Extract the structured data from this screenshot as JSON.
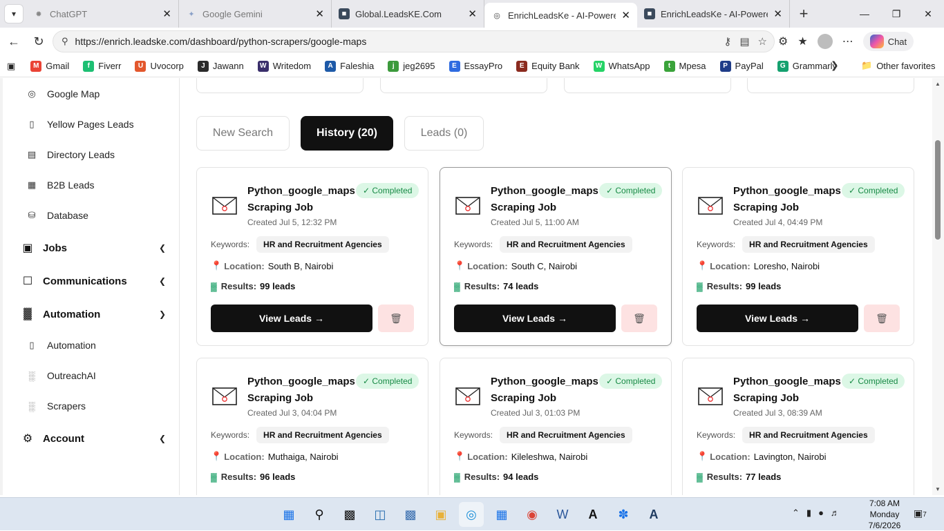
{
  "browser": {
    "tabs": [
      {
        "title": "ChatGPT",
        "favicon": "chatgpt-icon",
        "active": false,
        "dim": true
      },
      {
        "title": "Google Gemini",
        "favicon": "gemini-icon",
        "active": false,
        "dim": true
      },
      {
        "title": "Global.LeadsKE.Com",
        "favicon": "site-icon",
        "active": false,
        "dim": false
      },
      {
        "title": "EnrichLeadsKe - AI-Powered Le",
        "favicon": "globe-icon",
        "active": true,
        "dim": false
      },
      {
        "title": "EnrichLeadsKe - AI-Powered Le",
        "favicon": "site-icon",
        "active": false,
        "dim": false
      }
    ],
    "url": "https://enrich.leadske.com/dashboard/python-scrapers/google-maps",
    "chat_label": "Chat",
    "bookmarks": [
      {
        "label": "Gmail",
        "color": "#ea4335",
        "glyph": "M"
      },
      {
        "label": "Fiverr",
        "color": "#1dbf73",
        "glyph": "f"
      },
      {
        "label": "Uvocorp",
        "color": "#e3572d",
        "glyph": "U"
      },
      {
        "label": "Jawann",
        "color": "#2b2b2b",
        "glyph": "J"
      },
      {
        "label": "Writedom",
        "color": "#3a2f6b",
        "glyph": "W"
      },
      {
        "label": "Faleshia",
        "color": "#1e5aa8",
        "glyph": "A"
      },
      {
        "label": "jeg2695",
        "color": "#3c9a3c",
        "glyph": "j"
      },
      {
        "label": "EssayPro",
        "color": "#2f6be0",
        "glyph": "E"
      },
      {
        "label": "Equity Bank",
        "color": "#8b2b1f",
        "glyph": "E"
      },
      {
        "label": "WhatsApp",
        "color": "#25d366",
        "glyph": "W"
      },
      {
        "label": "Mpesa",
        "color": "#3aa33a",
        "glyph": "t"
      },
      {
        "label": "PayPal",
        "color": "#1f3c88",
        "glyph": "P"
      },
      {
        "label": "Grammarly",
        "color": "#15a16f",
        "glyph": "G"
      }
    ],
    "other_favorites": "Other favorites"
  },
  "sidebar": {
    "items": [
      {
        "label": "Google Map",
        "icon": "globe-icon"
      },
      {
        "label": "Yellow Pages Leads",
        "icon": "phone-icon"
      },
      {
        "label": "Directory Leads",
        "icon": "directory-icon"
      },
      {
        "label": "B2B Leads",
        "icon": "building-icon"
      },
      {
        "label": "Database",
        "icon": "database-icon"
      }
    ],
    "sections": [
      {
        "label": "Jobs",
        "icon": "briefcase-icon",
        "expanded": false
      },
      {
        "label": "Communications",
        "icon": "message-icon",
        "expanded": false
      },
      {
        "label": "Automation",
        "icon": "chart-icon",
        "expanded": true
      }
    ],
    "automation_items": [
      {
        "label": "Automation",
        "icon": "phone-icon"
      },
      {
        "label": "OutreachAI",
        "icon": "bar-chart-icon"
      },
      {
        "label": "Scrapers",
        "icon": "bar-chart-icon"
      }
    ],
    "account": {
      "label": "Account",
      "icon": "gear-icon"
    }
  },
  "tabs": {
    "new_search": "New Search",
    "history": "History (20)",
    "leads": "Leads (0)"
  },
  "labels": {
    "keywords": "Keywords:",
    "location": "Location:",
    "results": "Results:",
    "view_leads": "View Leads →",
    "status": "✓ Completed"
  },
  "jobs": [
    {
      "title": "Python_google_maps Scraping Job",
      "created": "Created Jul 5, 12:32 PM",
      "keyword": "HR and Recruitment Agencies",
      "location": "South B, Nairobi",
      "results": "99 leads"
    },
    {
      "title": "Python_google_maps Scraping Job",
      "created": "Created Jul 5, 11:00 AM",
      "keyword": "HR and Recruitment Agencies",
      "location": "South C, Nairobi",
      "results": "74 leads"
    },
    {
      "title": "Python_google_maps Scraping Job",
      "created": "Created Jul 4, 04:49 PM",
      "keyword": "HR and Recruitment Agencies",
      "location": "Loresho, Nairobi",
      "results": "99 leads"
    },
    {
      "title": "Python_google_maps Scraping Job",
      "created": "Created Jul 3, 04:04 PM",
      "keyword": "HR and Recruitment Agencies",
      "location": "Muthaiga, Nairobi",
      "results": "96 leads"
    },
    {
      "title": "Python_google_maps Scraping Job",
      "created": "Created Jul 3, 01:03 PM",
      "keyword": "HR and Recruitment Agencies",
      "location": "Kileleshwa, Nairobi",
      "results": "94 leads"
    },
    {
      "title": "Python_google_maps Scraping Job",
      "created": "Created Jul 3, 08:39 AM",
      "keyword": "HR and Recruitment Agencies",
      "location": "Lavington, Nairobi",
      "results": "77 leads"
    }
  ],
  "taskbar": {
    "time": "7:08 AM",
    "day": "Monday",
    "date": "7/6/2026",
    "notifications": "7"
  }
}
